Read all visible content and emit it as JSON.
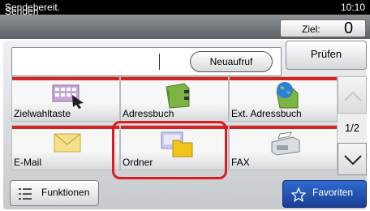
{
  "status": {
    "text": "Sendebereit.",
    "time": "10:10"
  },
  "title": "Senden",
  "ziel": {
    "label": "Ziel:",
    "count": "0"
  },
  "destination_input": {
    "value": ""
  },
  "buttons": {
    "neuaufruf": "Neuaufruf",
    "pruefen": "Prüfen",
    "funktionen": "Funktionen",
    "favoriten": "Favoriten"
  },
  "tiles": [
    {
      "label": "Zielwahltaste",
      "icon": "keyboard-icon"
    },
    {
      "label": "Adressbuch",
      "icon": "address-book-icon"
    },
    {
      "label": "Ext. Adressbuch",
      "icon": "globe-book-icon"
    },
    {
      "label": "E-Mail",
      "icon": "envelope-icon"
    },
    {
      "label": "Ordner",
      "icon": "folder-icon"
    },
    {
      "label": "FAX",
      "icon": "fax-icon"
    }
  ],
  "pagination": {
    "indicator": "1/2"
  },
  "colors": {
    "accent": "#d8241e",
    "favorite": "#1f4fae",
    "highlight": "#e0191e"
  }
}
